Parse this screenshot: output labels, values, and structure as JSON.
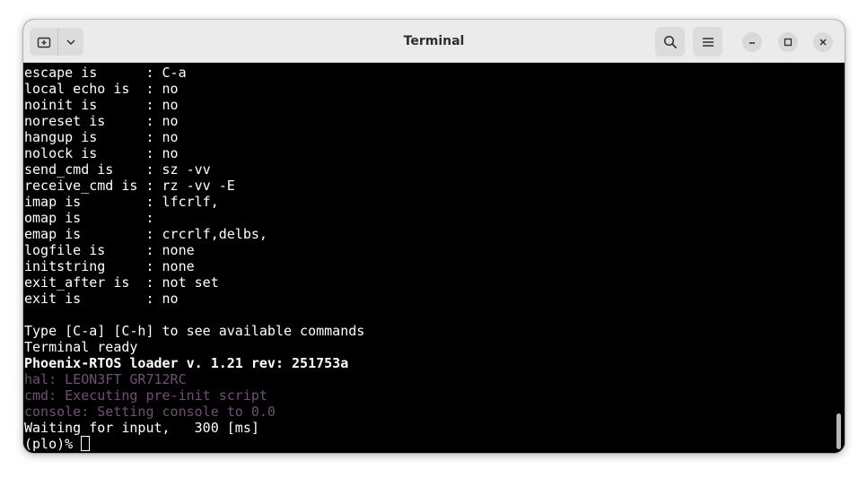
{
  "window": {
    "title": "Terminal"
  },
  "icons": {
    "new_tab": "new-tab-icon",
    "dropdown": "chevron-down-icon",
    "search": "search-icon",
    "menu": "hamburger-menu-icon",
    "minimize": "minimize-icon",
    "maximize": "maximize-icon",
    "close": "close-icon"
  },
  "colors": {
    "terminal_bg": "#000000",
    "text": "#ffffff",
    "dim_text": "#6f4f73",
    "headerbar": "#ebebeb"
  },
  "terminal": {
    "lines": [
      {
        "text": "escape is      : C-a",
        "style": "normal"
      },
      {
        "text": "local echo is  : no",
        "style": "normal"
      },
      {
        "text": "noinit is      : no",
        "style": "normal"
      },
      {
        "text": "noreset is     : no",
        "style": "normal"
      },
      {
        "text": "hangup is      : no",
        "style": "normal"
      },
      {
        "text": "nolock is      : no",
        "style": "normal"
      },
      {
        "text": "send_cmd is    : sz -vv",
        "style": "normal"
      },
      {
        "text": "receive_cmd is : rz -vv -E",
        "style": "normal"
      },
      {
        "text": "imap is        : lfcrlf,",
        "style": "normal"
      },
      {
        "text": "omap is        : ",
        "style": "normal"
      },
      {
        "text": "emap is        : crcrlf,delbs,",
        "style": "normal"
      },
      {
        "text": "logfile is     : none",
        "style": "normal"
      },
      {
        "text": "initstring     : none",
        "style": "normal"
      },
      {
        "text": "exit_after is  : not set",
        "style": "normal"
      },
      {
        "text": "exit is        : no",
        "style": "normal"
      },
      {
        "text": "",
        "style": "normal"
      },
      {
        "text": "Type [C-a] [C-h] to see available commands",
        "style": "normal"
      },
      {
        "text": "Terminal ready",
        "style": "normal"
      },
      {
        "text": "Phoenix-RTOS loader v. 1.21 rev: 251753a",
        "style": "bold"
      },
      {
        "text": "hal: LEON3FT GR712RC",
        "style": "dim"
      },
      {
        "text": "cmd: Executing pre-init script",
        "style": "dim"
      },
      {
        "text": "console: Setting console to 0.0",
        "style": "dim"
      },
      {
        "text": "Waiting for input,   300 [ms]",
        "style": "normal"
      }
    ],
    "prompt": "(plo)% "
  }
}
